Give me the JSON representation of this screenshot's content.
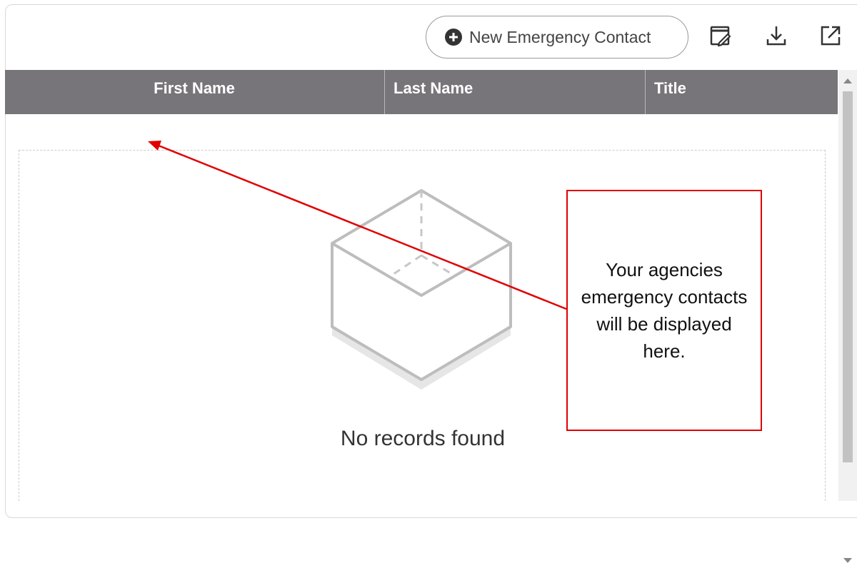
{
  "toolbar": {
    "new_contact_label": "New Emergency Contact",
    "icons": [
      "plus-circle-icon",
      "edit-columns-icon",
      "download-icon",
      "open-external-icon"
    ]
  },
  "grid": {
    "columns": [
      "First Name",
      "Last Name",
      "Title"
    ],
    "empty_message": "No records found"
  },
  "annotation": {
    "text": "Your agencies emergency contacts will be displayed here.",
    "color": "#e00000"
  },
  "colors": {
    "header_bg": "#78757a",
    "header_text": "#ffffff"
  }
}
